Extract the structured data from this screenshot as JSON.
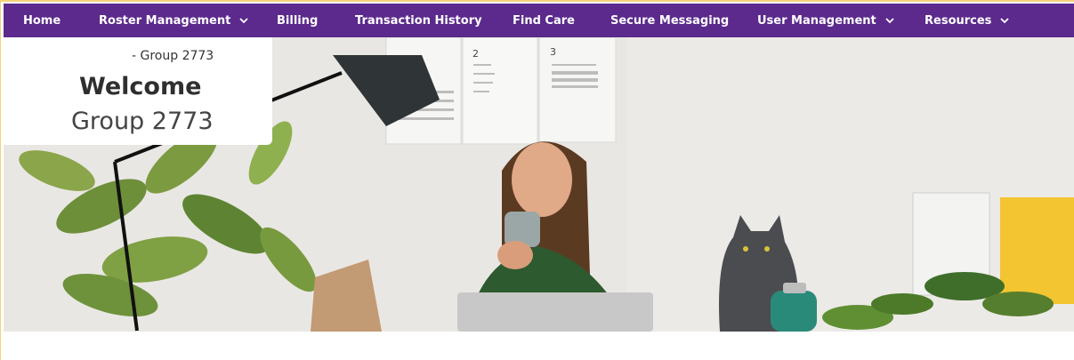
{
  "nav": {
    "items": [
      {
        "label": "Home",
        "has_dropdown": false
      },
      {
        "label": "Roster Management",
        "has_dropdown": true
      },
      {
        "label": "Billing",
        "has_dropdown": false
      },
      {
        "label": "Transaction History",
        "has_dropdown": false
      },
      {
        "label": "Find Care",
        "has_dropdown": false
      },
      {
        "label": "Secure Messaging",
        "has_dropdown": false
      },
      {
        "label": "User Management",
        "has_dropdown": true
      },
      {
        "label": "Resources",
        "has_dropdown": true
      }
    ],
    "background": "#5b2a8c",
    "text_color": "#ffffff"
  },
  "welcome": {
    "breadcrumb": "- Group 2773",
    "title": "Welcome",
    "group_name": "Group 2773"
  },
  "hero": {
    "calendar_pages": [
      "2",
      "3"
    ]
  }
}
